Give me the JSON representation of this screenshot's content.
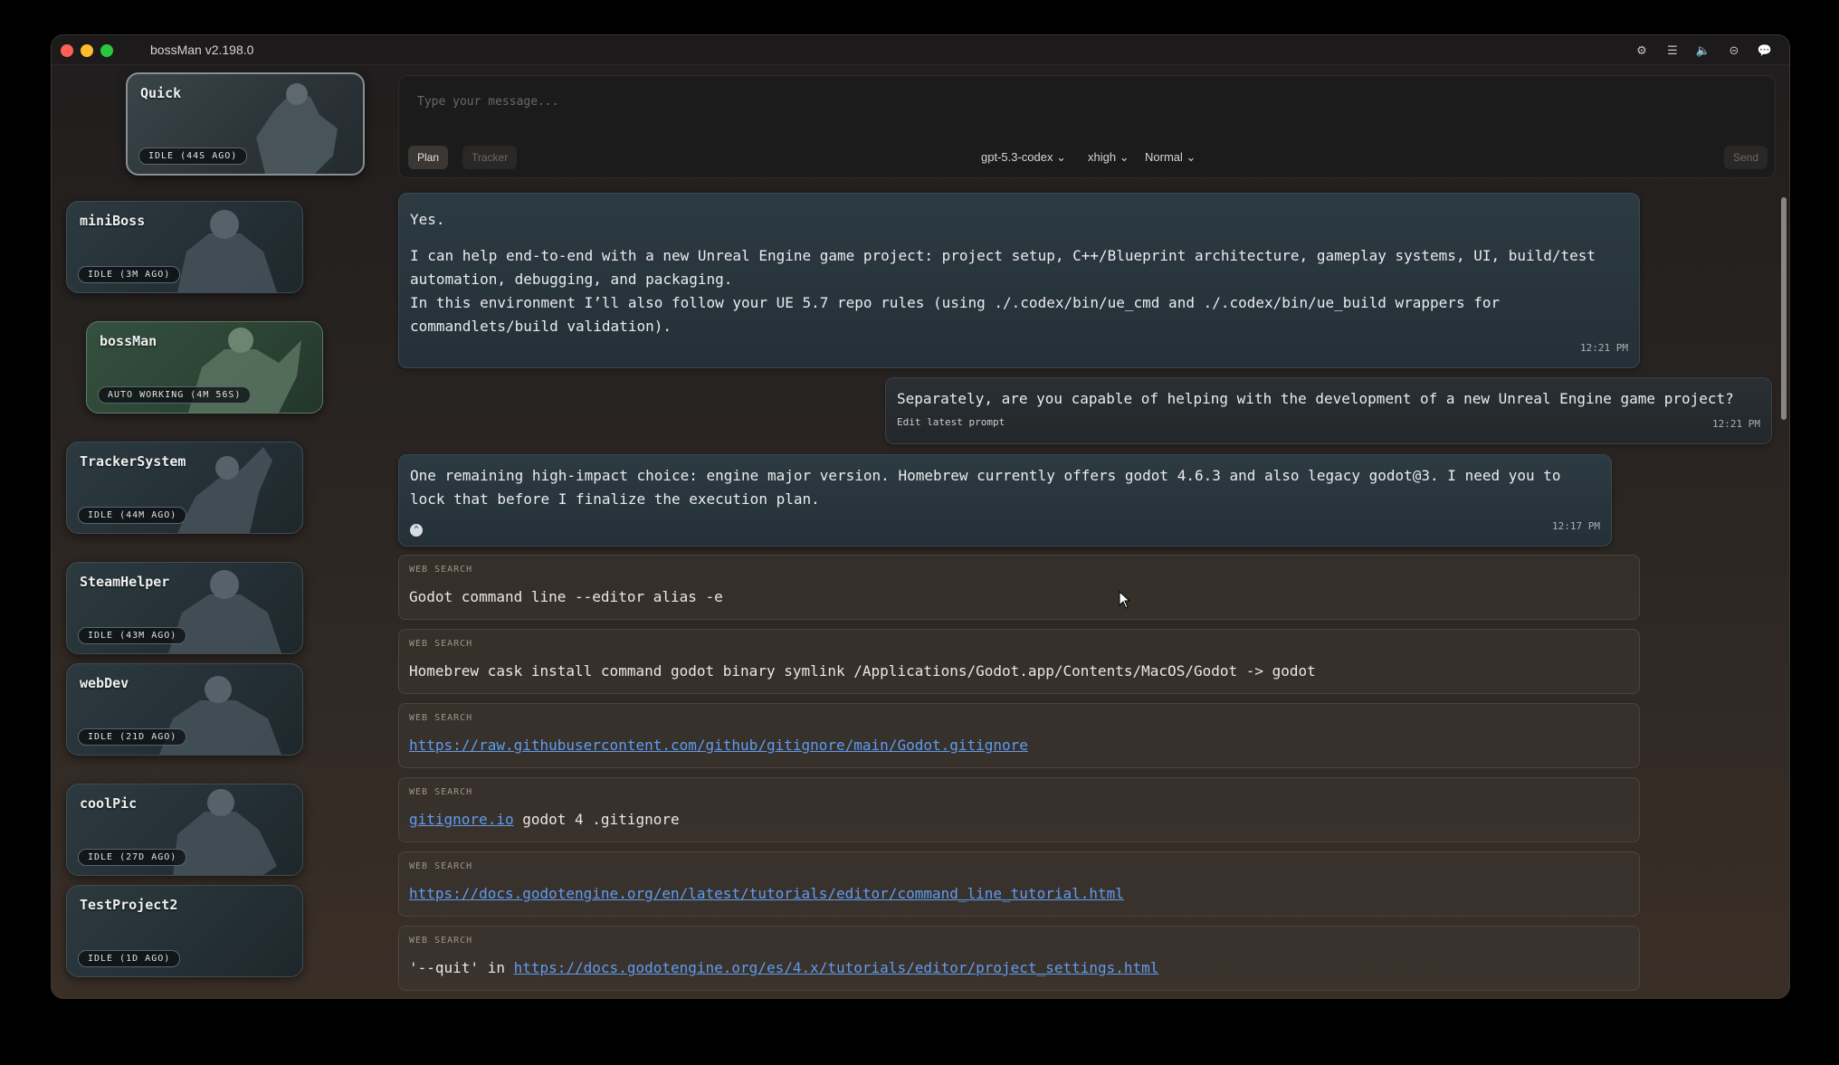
{
  "app": {
    "title": "bossMan v2.198.0"
  },
  "titlebar_icons": [
    "gear-icon",
    "list-icon",
    "speaker-icon",
    "circle-dash-icon",
    "chat-icon"
  ],
  "titlebar_glyphs": [
    "⚙",
    "☰",
    "🔈",
    "⊝",
    "💬"
  ],
  "agents": [
    {
      "name": "Quick",
      "status": "IDLE (44S AGO)"
    },
    {
      "name": "miniBoss",
      "status": "IDLE (3M AGO)"
    },
    {
      "name": "bossMan",
      "status": "AUTO WORKING (4M 56S)"
    },
    {
      "name": "TrackerSystem",
      "status": "IDLE (44M AGO)"
    },
    {
      "name": "SteamHelper",
      "status": "IDLE (43M AGO)"
    },
    {
      "name": "webDev",
      "status": "IDLE (21D AGO)"
    },
    {
      "name": "coolPic",
      "status": "IDLE (27D AGO)"
    },
    {
      "name": "TestProject2",
      "status": "IDLE (1D AGO)"
    }
  ],
  "composer": {
    "placeholder": "Type your message...",
    "plan_label": "Plan",
    "tracker_label": "Tracker",
    "model": "gpt-5.3-codex",
    "reasoning": "xhigh",
    "mode": "Normal",
    "send_label": "Send"
  },
  "messages": {
    "m1": {
      "line1": "Yes.",
      "line2": "I can help end-to-end with a new Unreal Engine game project: project setup, C++/Blueprint architecture, gameplay systems, UI, build/test automation, debugging, and packaging.",
      "line3": "In this environment I’ll also follow your UE 5.7 repo rules (using ./.codex/bin/ue_cmd and ./.codex/bin/ue_build wrappers for commandlets/build validation).",
      "time": "12:21 PM"
    },
    "m2": {
      "text": "Separately, are you capable of helping with the development of a new Unreal Engine game project?",
      "edit": "Edit latest prompt",
      "time": "12:21 PM"
    },
    "m3": {
      "text": "One remaining high-impact choice: engine major version. Homebrew currently offers godot 4.6.3 and also legacy godot@3. I need you to lock that before I finalize the execution plan.",
      "time": "12:17 PM"
    }
  },
  "searches": {
    "label": "WEB SEARCH",
    "s1": "Godot command line --editor alias -e",
    "s2": "Homebrew cask install command godot binary symlink /Applications/Godot.app/Contents/MacOS/Godot -> godot",
    "s3": "https://raw.githubusercontent.com/github/gitignore/main/Godot.gitignore",
    "s4_link": "gitignore.io",
    "s4_rest": " godot 4 .gitignore",
    "s5": "https://docs.godotengine.org/en/latest/tutorials/editor/command_line_tutorial.html",
    "s6_pre": "'--quit' in ",
    "s6_link": "https://docs.godotengine.org/es/4.x/tutorials/editor/project_settings.html"
  }
}
